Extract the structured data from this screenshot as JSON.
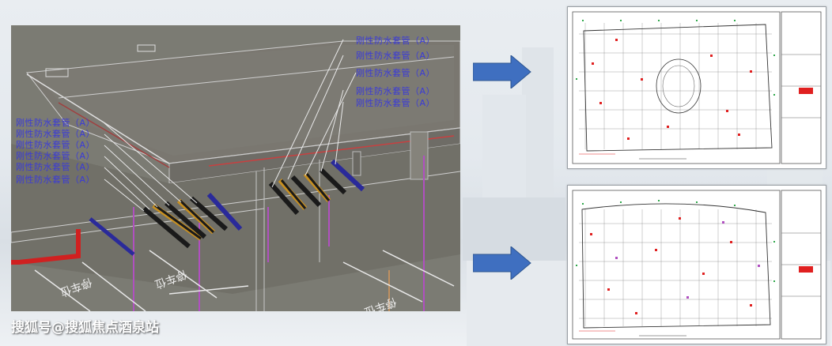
{
  "bim_model": {
    "callouts_right": [
      "刚性防水套管（A）",
      "刚性防水套管（A）",
      "刚性防水套管（A）",
      "刚性防水套管（A）",
      "刚性防水套管（A）"
    ],
    "callouts_left": [
      "刚性防水套管（A）",
      "刚性防水套管（A）",
      "刚性防水套管（A）",
      "刚性防水套管（A）",
      "刚性防水套管（A）",
      "刚性防水套管（A）"
    ],
    "floor_marking": "停车位"
  },
  "watermark": "搜狐号@搜狐焦点酒泉站",
  "colors": {
    "callout_text": "#3a3ad8",
    "arrow_fill": "#3f6fc0",
    "drawing_red": "#e02020",
    "drawing_green": "#2fa84a"
  }
}
